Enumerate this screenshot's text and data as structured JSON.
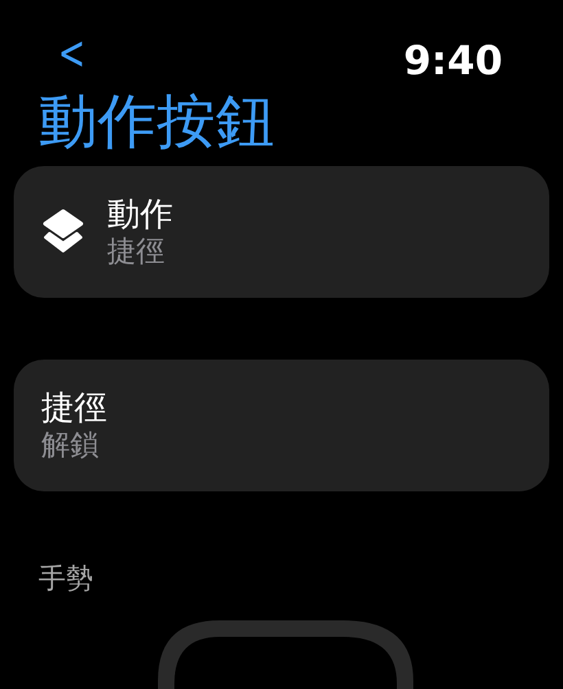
{
  "status_bar": {
    "back": "<",
    "time": "9:40"
  },
  "title": "動作按鈕",
  "settings": [
    {
      "kind": "icon",
      "title": "動作",
      "subtitle": "捷徑"
    },
    {
      "kind": "plain",
      "title": "捷徑",
      "subtitle": "解鎖"
    }
  ],
  "section_header": "手勢"
}
